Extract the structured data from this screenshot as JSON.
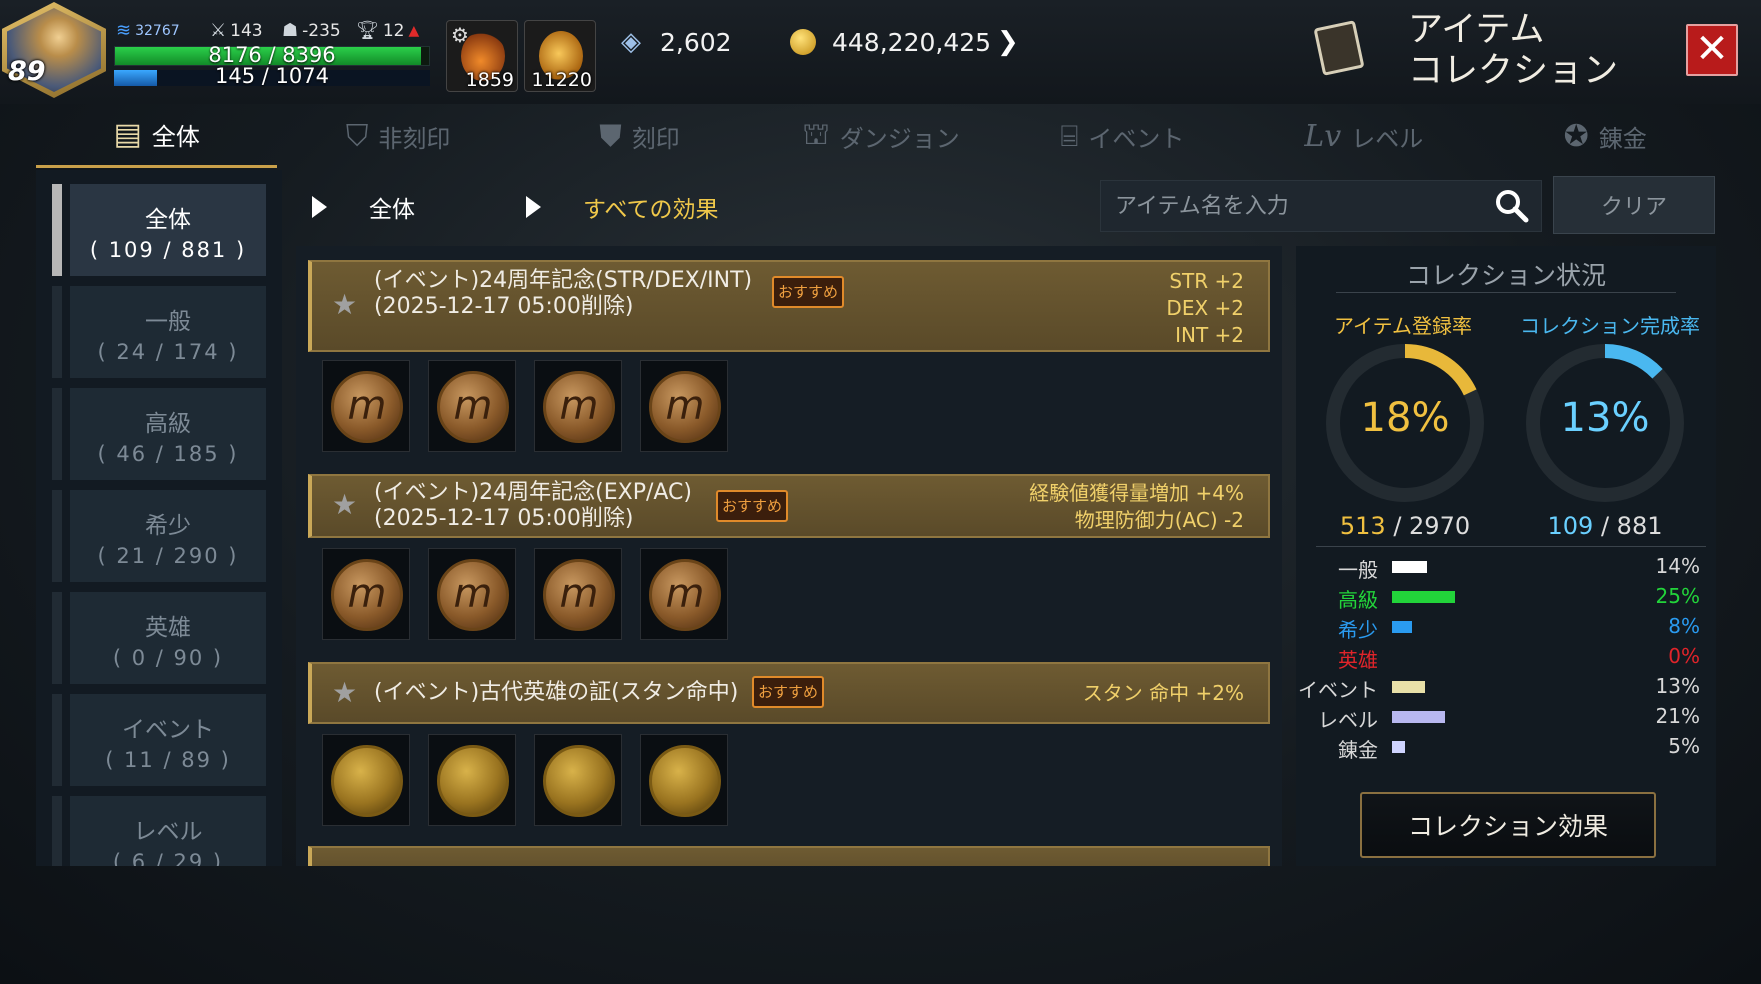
{
  "player": {
    "level": "89",
    "combat_power": "32767",
    "attack": "143",
    "defense": "-235",
    "trophy": "12",
    "hp": "8176 / 8396",
    "hp_ratio": 0.974,
    "mp": "145 / 1074",
    "mp_ratio": 0.135
  },
  "potions": [
    {
      "name": "potion-bottle-icon",
      "count": "1859"
    },
    {
      "name": "leaf-potion-icon",
      "count": "11220"
    }
  ],
  "currencies": {
    "gems": "2,602",
    "gold": "448,220,425"
  },
  "header": {
    "title": "アイテム\nコレクション",
    "close_icon": "close-icon"
  },
  "tabs": [
    {
      "label": "全体",
      "icon": "book-icon",
      "active": true
    },
    {
      "label": "非刻印",
      "icon": "shield-icon",
      "active": false
    },
    {
      "label": "刻印",
      "icon": "stamp-shield-icon",
      "active": false
    },
    {
      "label": "ダンジョン",
      "icon": "dungeon-gate-icon",
      "active": false
    },
    {
      "label": "イベント",
      "icon": "gift-icon",
      "active": false
    },
    {
      "label": "レベル",
      "icon": "lv-icon",
      "active": false
    },
    {
      "label": "錬金",
      "icon": "pentagram-icon",
      "active": false
    }
  ],
  "categories": [
    {
      "name": "全体",
      "count": "( 109 / 881 )",
      "active": true
    },
    {
      "name": "一般",
      "count": "( 24 / 174 )",
      "active": false
    },
    {
      "name": "高級",
      "count": "( 46 / 185 )",
      "active": false
    },
    {
      "name": "希少",
      "count": "( 21 / 290 )",
      "active": false
    },
    {
      "name": "英雄",
      "count": "( 0 / 90 )",
      "active": false
    },
    {
      "name": "イベント",
      "count": "( 11 / 89 )",
      "active": false
    },
    {
      "name": "レベル",
      "count": "( 6 / 29 )",
      "active": false
    }
  ],
  "filters": {
    "category": "全体",
    "effect": "すべての効果"
  },
  "search": {
    "placeholder": "アイテム名を入力",
    "clear_label": "クリア"
  },
  "collections": [
    {
      "title_line1": "(イベント)24周年記念(STR/DEX/INT)",
      "title_line2": "(2025-12-17  05:00削除)",
      "recommended": "おすすめ",
      "effects": [
        "STR  +2",
        "DEX  +2",
        "INT  +2"
      ]
    },
    {
      "title_line1": "(イベント)24周年記念(EXP/AC)",
      "title_line2": "(2025-12-17  05:00削除)",
      "recommended": "おすすめ",
      "effects": [
        "経験値獲得量増加  +4%",
        "物理防御力(AC)  -2"
      ]
    },
    {
      "title_line1": "(イベント)古代英雄の証(スタン命中)",
      "title_line2": "",
      "recommended": "おすすめ",
      "effects": [
        "スタン  命中  +2%"
      ]
    }
  ],
  "status": {
    "title": "コレクション状況",
    "item_rate_label": "アイテム登録率",
    "complete_rate_label": "コレクション完成率",
    "item_rate": "18%",
    "complete_rate": "13%",
    "item_rate_value": 0.18,
    "complete_rate_value": 0.13,
    "item_count": "513",
    "item_total": "2970",
    "complete_count": "109",
    "complete_total": "881",
    "rarity_rows": [
      {
        "label": "一般",
        "pct": "14%",
        "value": 0.14,
        "color": "#ffffff"
      },
      {
        "label": "高級",
        "pct": "25%",
        "value": 0.25,
        "color": "#22d43a"
      },
      {
        "label": "希少",
        "pct": "8%",
        "value": 0.08,
        "color": "#2a9bf0"
      },
      {
        "label": "英雄",
        "pct": "0%",
        "value": 0.0,
        "color": "#e0242a"
      },
      {
        "label": "イベント",
        "pct": "13%",
        "value": 0.13,
        "color": "#e8e0a8"
      },
      {
        "label": "レベル",
        "pct": "21%",
        "value": 0.21,
        "color": "#b8b8f0"
      },
      {
        "label": "錬金",
        "pct": "5%",
        "value": 0.05,
        "color": "#cfd4ff"
      }
    ],
    "effect_button": "コレクション効果"
  },
  "colors": {
    "gold_accent": "#e8b83a",
    "blue_accent": "#4ab8f0"
  }
}
